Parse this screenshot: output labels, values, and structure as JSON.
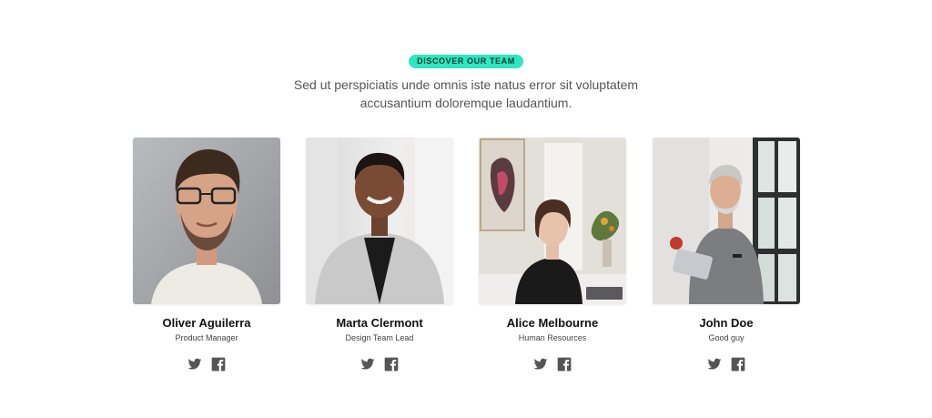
{
  "header": {
    "badge": "DISCOVER OUR TEAM",
    "subtitle": "Sed ut perspiciatis unde omnis iste natus error sit voluptatem accusantium doloremque laudantium."
  },
  "team": [
    {
      "name": "Oliver Aguilerra",
      "role": "Product Manager",
      "photo": "portrait-man-glasses"
    },
    {
      "name": "Marta Clermont",
      "role": "Design Team Lead",
      "photo": "portrait-woman-blazer"
    },
    {
      "name": "Alice Melbourne",
      "role": "Human Resources",
      "photo": "portrait-woman-office"
    },
    {
      "name": "John Doe",
      "role": "Good guy",
      "photo": "portrait-man-tablet"
    }
  ],
  "social_icons": [
    "twitter-icon",
    "facebook-icon"
  ],
  "colors": {
    "badge_bg": "#2ee6bf",
    "icon": "#555555"
  }
}
